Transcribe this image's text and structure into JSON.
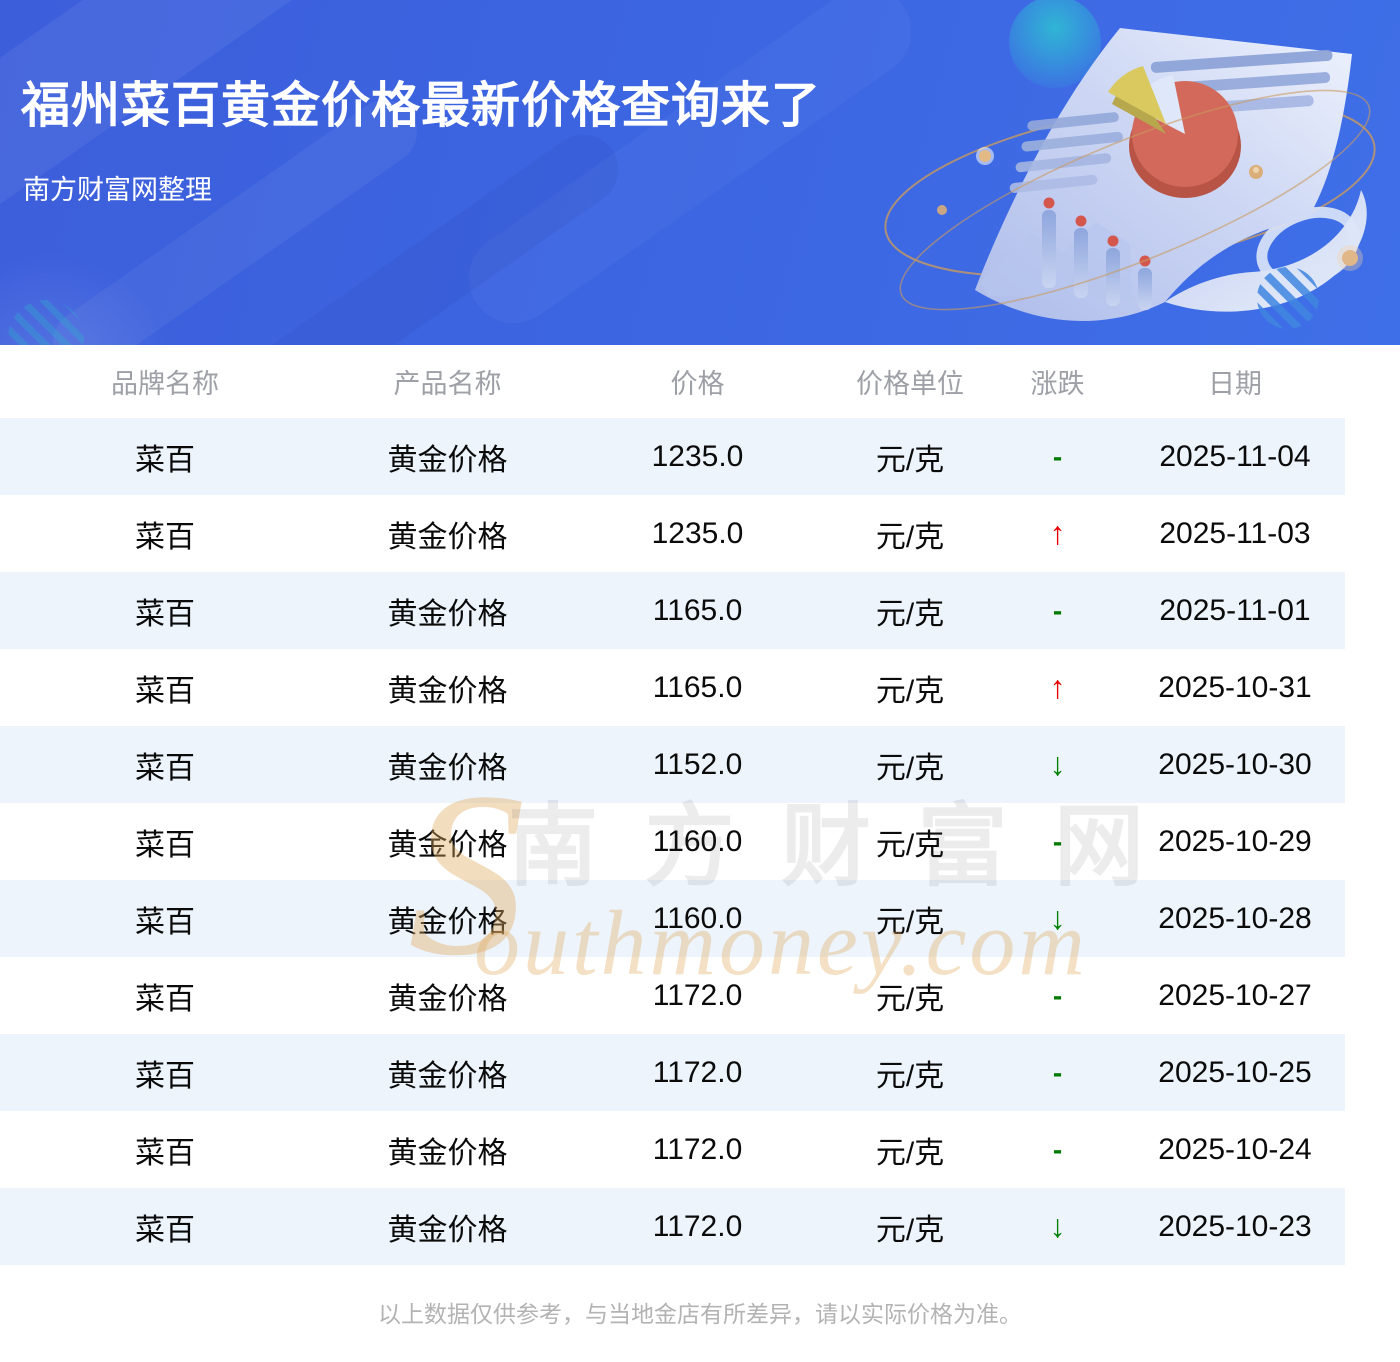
{
  "header": {
    "title": "福州菜百黄金价格最新价格查询来了",
    "subtitle": "南方财富网整理"
  },
  "table": {
    "columns": [
      "品牌名称",
      "产品名称",
      "价格",
      "价格单位",
      "涨跌",
      "日期"
    ],
    "change_symbols": {
      "up": "↑",
      "down": "↓",
      "flat": "-"
    },
    "rows": [
      {
        "brand": "菜百",
        "product": "黄金价格",
        "price": "1235.0",
        "unit": "元/克",
        "change": "flat",
        "date": "2025-11-04"
      },
      {
        "brand": "菜百",
        "product": "黄金价格",
        "price": "1235.0",
        "unit": "元/克",
        "change": "up",
        "date": "2025-11-03"
      },
      {
        "brand": "菜百",
        "product": "黄金价格",
        "price": "1165.0",
        "unit": "元/克",
        "change": "flat",
        "date": "2025-11-01"
      },
      {
        "brand": "菜百",
        "product": "黄金价格",
        "price": "1165.0",
        "unit": "元/克",
        "change": "up",
        "date": "2025-10-31"
      },
      {
        "brand": "菜百",
        "product": "黄金价格",
        "price": "1152.0",
        "unit": "元/克",
        "change": "down",
        "date": "2025-10-30"
      },
      {
        "brand": "菜百",
        "product": "黄金价格",
        "price": "1160.0",
        "unit": "元/克",
        "change": "flat",
        "date": "2025-10-29"
      },
      {
        "brand": "菜百",
        "product": "黄金价格",
        "price": "1160.0",
        "unit": "元/克",
        "change": "down",
        "date": "2025-10-28"
      },
      {
        "brand": "菜百",
        "product": "黄金价格",
        "price": "1172.0",
        "unit": "元/克",
        "change": "flat",
        "date": "2025-10-27"
      },
      {
        "brand": "菜百",
        "product": "黄金价格",
        "price": "1172.0",
        "unit": "元/克",
        "change": "flat",
        "date": "2025-10-25"
      },
      {
        "brand": "菜百",
        "product": "黄金价格",
        "price": "1172.0",
        "unit": "元/克",
        "change": "flat",
        "date": "2025-10-24"
      },
      {
        "brand": "菜百",
        "product": "黄金价格",
        "price": "1172.0",
        "unit": "元/克",
        "change": "down",
        "date": "2025-10-23"
      }
    ]
  },
  "watermark": {
    "initial": "S",
    "cn": "南 方 财 富 网",
    "en": "outhmoney.com"
  },
  "footer": {
    "disclaimer": "以上数据仅供参考，与当地金店有所差异，请以实际价格为准。"
  },
  "colors": {
    "banner_start": "#3d5edb",
    "banner_end": "#3f6fe8",
    "row_alt_bg": "#edf4fc",
    "up_red": "#e60000",
    "down_green": "#008000",
    "header_text": "#9da0a6",
    "disclaimer_text": "#b3b3b3"
  }
}
